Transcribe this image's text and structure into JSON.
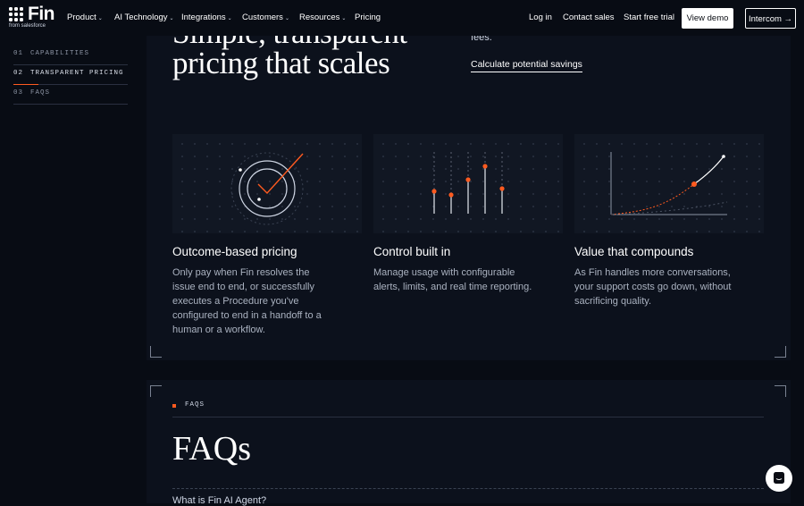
{
  "nav": {
    "logo_word": "Fin",
    "logo_sub": "from salesforce",
    "items": [
      {
        "label": "Product",
        "dropdown": true
      },
      {
        "label": "AI Technology",
        "dropdown": true
      },
      {
        "label": "Integrations",
        "dropdown": true
      },
      {
        "label": "Customers",
        "dropdown": true
      },
      {
        "label": "Resources",
        "dropdown": true
      },
      {
        "label": "Pricing",
        "dropdown": false
      }
    ],
    "login": "Log in",
    "contact": "Contact sales",
    "trial": "Start free trial",
    "demo": "View demo",
    "intercom": "Intercom →"
  },
  "sidebar": {
    "items": [
      {
        "num": "01",
        "label": "CAPABILITIES"
      },
      {
        "num": "02",
        "label": "TRANSPARENT PRICING",
        "active": true
      },
      {
        "num": "03",
        "label": "FAQS"
      }
    ]
  },
  "hero": {
    "title_line1": "Simple, transparent",
    "title_line2": "pricing that scales",
    "fees_text": "fees.",
    "calc_link": "Calculate potential savings"
  },
  "cards": [
    {
      "title": "Outcome-based pricing",
      "desc": "Only pay when Fin resolves the issue end to end, or successfully executes a Procedure you've configured to end in a handoff to a human or a workflow."
    },
    {
      "title": "Control built in",
      "desc": "Manage usage with configurable alerts, limits, and real time reporting."
    },
    {
      "title": "Value that compounds",
      "desc": "As Fin handles more conversations, your support costs go down, without sacrificing quality."
    }
  ],
  "faqs": {
    "label": "FAQS",
    "title": "FAQs",
    "first_question": "What is Fin AI Agent?"
  },
  "colors": {
    "accent": "#ff5a1f",
    "bg": "#080c14",
    "panel": "#0c111c"
  },
  "icons": [
    "chevron-down-icon",
    "arrow-right-icon",
    "chat-icon"
  ]
}
